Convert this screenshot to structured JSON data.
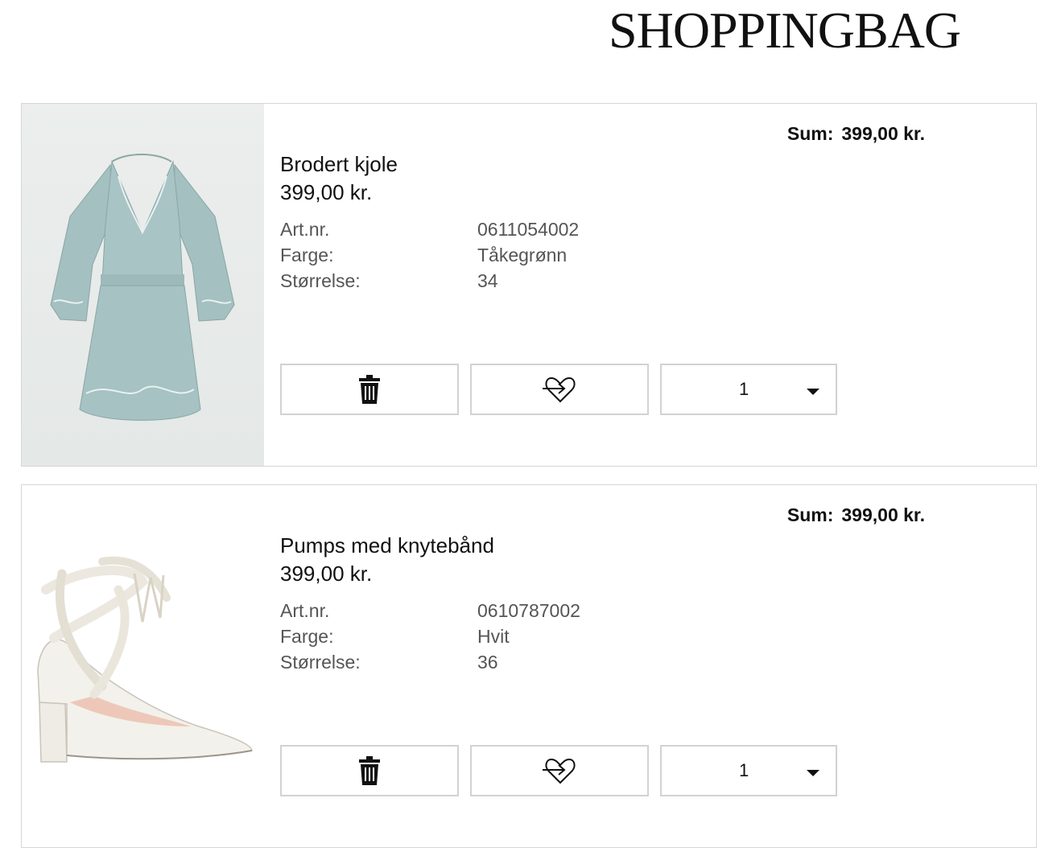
{
  "page": {
    "title": "SHOPPINGBAG"
  },
  "items": [
    {
      "name": "Brodert kjole",
      "price": "399,00 kr.",
      "sum_label": "Sum:",
      "sum_value": "399,00 kr.",
      "specs": [
        {
          "key": "Art.nr.",
          "value": "0611054002"
        },
        {
          "key": "Farge:",
          "value": "Tåkegrønn"
        },
        {
          "key": "Størrelse:",
          "value": "34"
        }
      ],
      "quantity": "1",
      "image_icon": "dress-image",
      "image_color": "#9fbcbd"
    },
    {
      "name": "Pumps med knytebånd",
      "price": "399,00 kr.",
      "sum_label": "Sum:",
      "sum_value": "399,00 kr.",
      "specs": [
        {
          "key": "Art.nr.",
          "value": "0610787002"
        },
        {
          "key": "Farge:",
          "value": "Hvit"
        },
        {
          "key": "Størrelse:",
          "value": "36"
        }
      ],
      "quantity": "1",
      "image_icon": "pumps-image",
      "image_color": "#f1efe9"
    }
  ],
  "icons": {
    "delete": "trash-icon",
    "favorite": "heart-arrow-icon",
    "dropdown": "caret-down-icon"
  }
}
